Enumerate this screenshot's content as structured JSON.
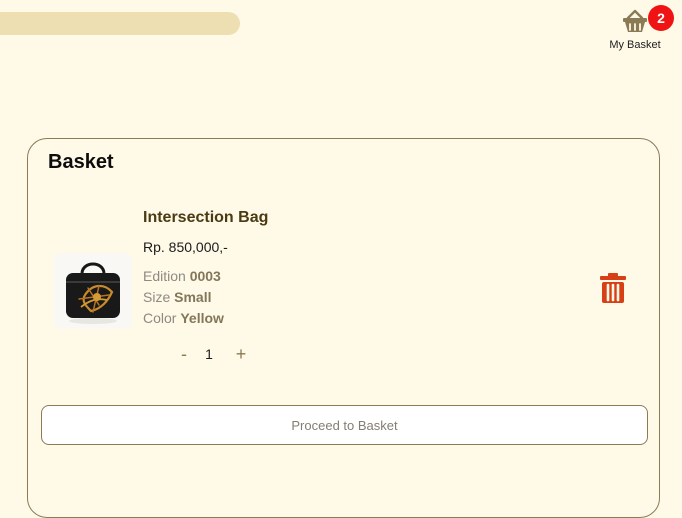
{
  "header": {
    "basket_label": "My Basket",
    "basket_count": "2",
    "basket_icon": "basket-icon",
    "badge_color": "#ef1313",
    "brand_tone": "#8b7b55"
  },
  "basket": {
    "title": "Basket",
    "items": [
      {
        "image_icon": "handbag-icon",
        "name": "Intersection Bag",
        "price": "Rp. 850,000,-",
        "edition_label": "Edition",
        "edition_value": "0003",
        "size_label": "Size",
        "size_value": "Small",
        "color_label": "Color",
        "color_value": "Yellow",
        "quantity": "1",
        "quantity_minus": "-",
        "quantity_plus": "+",
        "delete_icon": "trash-icon",
        "delete_color": "#d74016"
      }
    ],
    "proceed_label": "Proceed to Basket"
  }
}
